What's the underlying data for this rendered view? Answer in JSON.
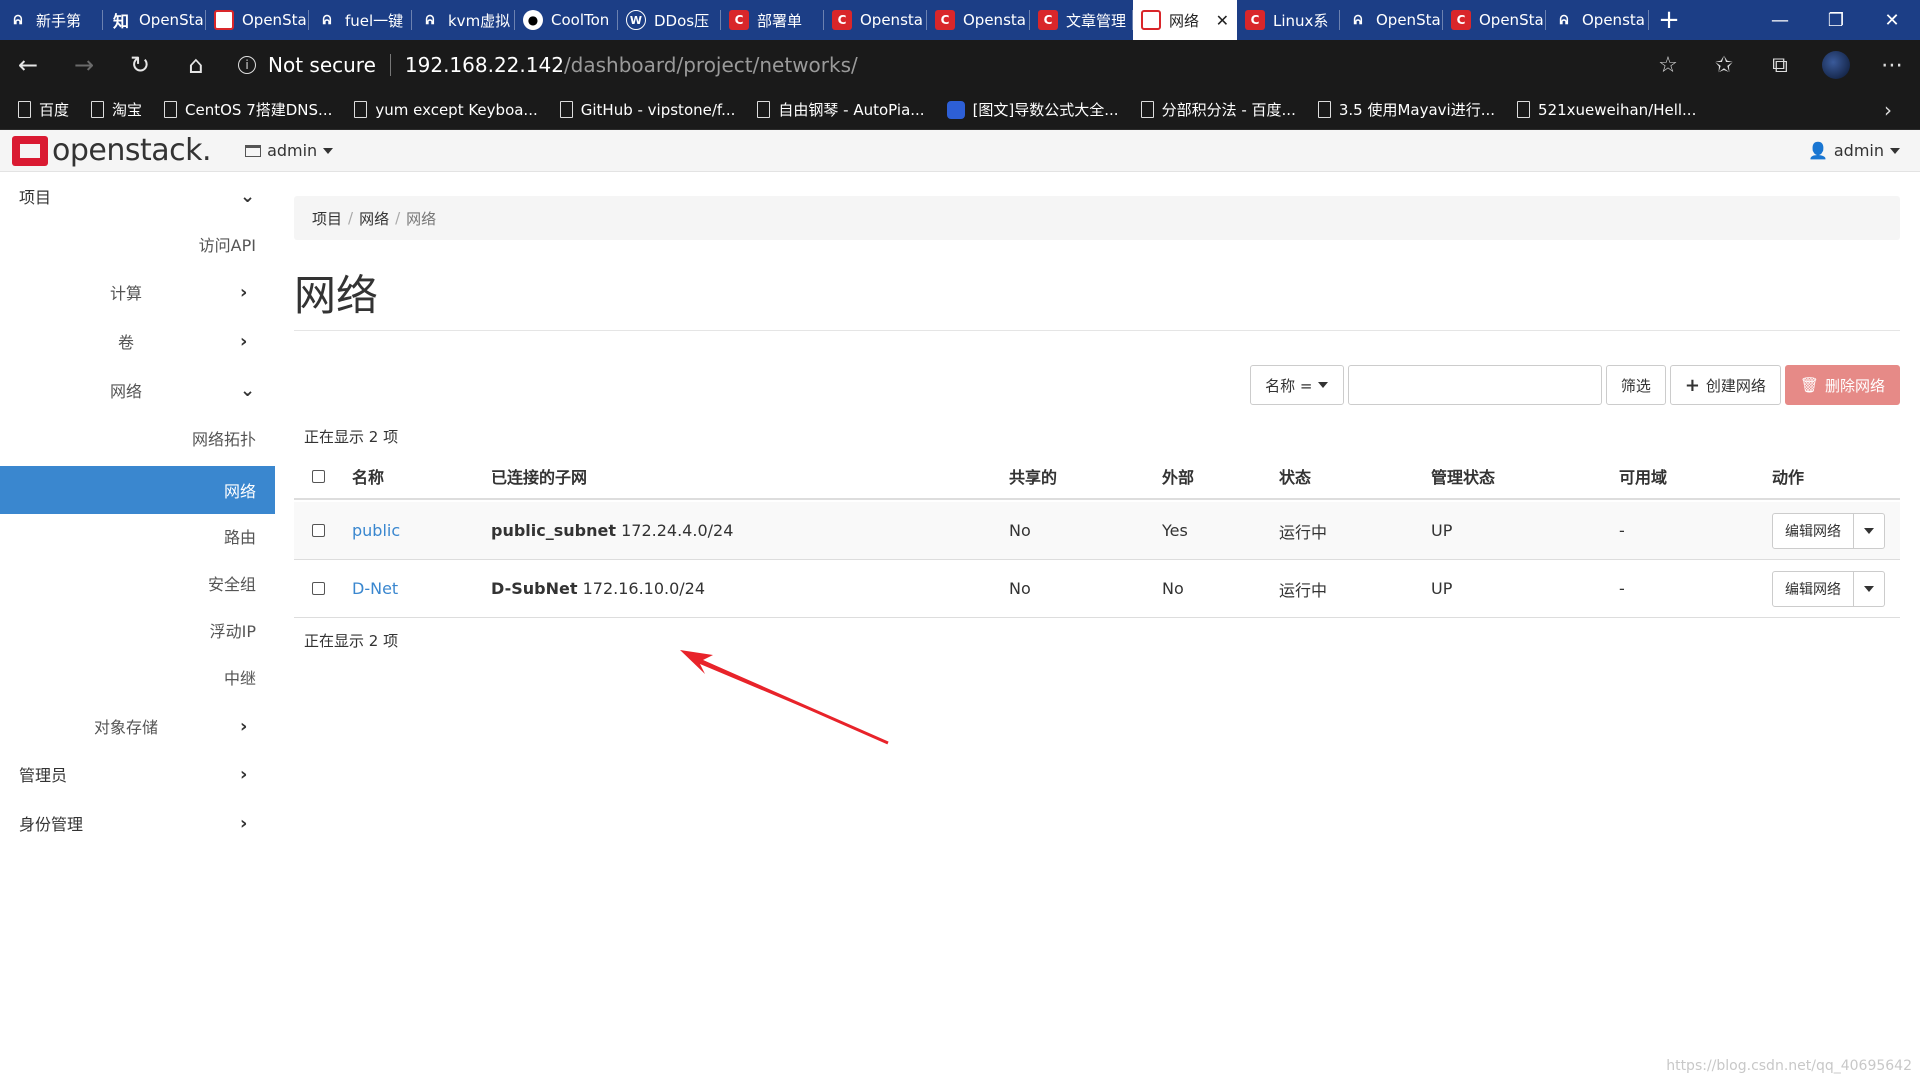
{
  "browser": {
    "tabs": [
      {
        "label": "新手第",
        "icon": "baidu-paw-icon"
      },
      {
        "label": "OpenSta",
        "icon": "zhihu-icon"
      },
      {
        "label": "OpenSta",
        "icon": "openstack-icon"
      },
      {
        "label": "fuel一键",
        "icon": "baidu-paw-icon"
      },
      {
        "label": "kvm虚拟",
        "icon": "baidu-paw-icon"
      },
      {
        "label": "CoolTon",
        "icon": "github-icon"
      },
      {
        "label": "DDos压",
        "icon": "wordpress-icon"
      },
      {
        "label": "部署单",
        "icon": "csdn-icon"
      },
      {
        "label": "Opensta",
        "icon": "csdn-icon"
      },
      {
        "label": "Opensta",
        "icon": "csdn-icon"
      },
      {
        "label": "文章管理",
        "icon": "csdn-icon"
      },
      {
        "label": "网络",
        "icon": "openstack-icon",
        "active": true
      },
      {
        "label": "Linux系",
        "icon": "csdn-icon"
      },
      {
        "label": "OpenSta",
        "icon": "baidu-paw-icon"
      },
      {
        "label": "OpenSta",
        "icon": "csdn-icon"
      },
      {
        "label": "Opensta",
        "icon": "baidu-paw-icon"
      }
    ],
    "security_label": "Not secure",
    "url_host": "192.168.22.142",
    "url_path": "/dashboard/project/networks/",
    "bookmarks": [
      {
        "label": "百度",
        "icon": "page-icon"
      },
      {
        "label": "淘宝",
        "icon": "page-icon"
      },
      {
        "label": "CentOS 7搭建DNS...",
        "icon": "page-icon"
      },
      {
        "label": "yum except Keyboa...",
        "icon": "page-icon"
      },
      {
        "label": "GitHub - vipstone/f...",
        "icon": "page-icon"
      },
      {
        "label": "自由钢琴 - AutoPia...",
        "icon": "page-icon"
      },
      {
        "label": "[图文]导数公式大全...",
        "icon": "baidu-paw-icon"
      },
      {
        "label": "分部积分法 - 百度...",
        "icon": "page-icon"
      },
      {
        "label": "3.5 使用Mayavi进行...",
        "icon": "page-icon"
      },
      {
        "label": "521xueweihan/Hell...",
        "icon": "page-icon"
      }
    ]
  },
  "header": {
    "logo_text": "openstack.",
    "project_label": "admin",
    "user_label": "admin"
  },
  "sidebar": {
    "project": "项目",
    "access_api": "访问API",
    "compute": "计算",
    "volumes": "卷",
    "network": "网络",
    "network_topology": "网络拓扑",
    "networks": "网络",
    "routers": "路由",
    "security_groups": "安全组",
    "floating_ips": "浮动IP",
    "trunks": "中继",
    "object_store": "对象存储",
    "admin": "管理员",
    "identity": "身份管理"
  },
  "breadcrumb": {
    "l1": "项目",
    "l2": "网络",
    "l3": "网络"
  },
  "page": {
    "title": "网络",
    "filter_field": "名称 =",
    "filter_value": "",
    "filter_button": "筛选",
    "create_button": "创建网络",
    "delete_button": "删除网络",
    "count_top": "正在显示 2 项",
    "count_bottom": "正在显示 2 项"
  },
  "table": {
    "columns": [
      "名称",
      "已连接的子网",
      "共享的",
      "外部",
      "状态",
      "管理状态",
      "可用域",
      "动作"
    ],
    "rows": [
      {
        "name": "public",
        "subnet_name": "public_subnet",
        "subnet_cidr": "172.24.4.0/24",
        "shared": "No",
        "external": "Yes",
        "status": "运行中",
        "admin_state": "UP",
        "az": "-",
        "action": "编辑网络"
      },
      {
        "name": "D-Net",
        "subnet_name": "D-SubNet",
        "subnet_cidr": "172.16.10.0/24",
        "shared": "No",
        "external": "No",
        "status": "运行中",
        "admin_state": "UP",
        "az": "-",
        "action": "编辑网络"
      }
    ]
  },
  "watermark": "https://blog.csdn.net/qq_40695642",
  "colors": {
    "accent": "#3a87cf",
    "danger": "#e68a87",
    "tabbar": "#1c3e86",
    "brand": "#da1a32",
    "annotation_arrow": "#e8232a"
  }
}
